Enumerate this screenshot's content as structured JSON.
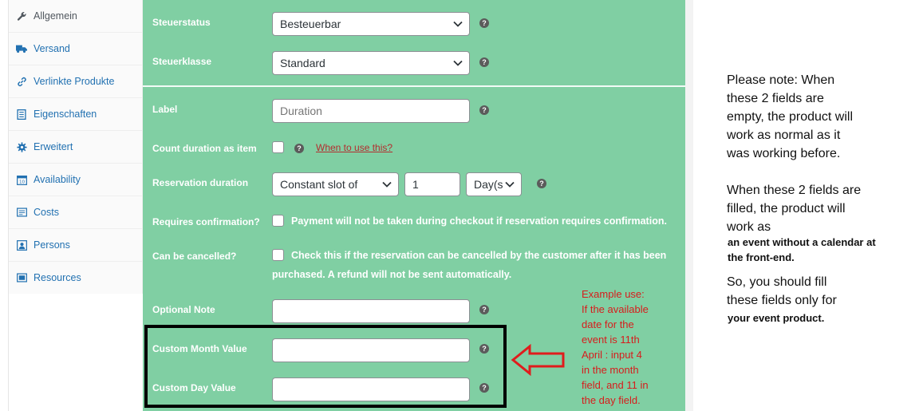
{
  "sidebar": {
    "items": [
      {
        "label": "Allgemein",
        "icon": "wrench-icon"
      },
      {
        "label": "Versand",
        "icon": "truck-icon"
      },
      {
        "label": "Verlinkte Produkte",
        "icon": "link-icon"
      },
      {
        "label": "Eigenschaften",
        "icon": "list-icon"
      },
      {
        "label": "Erweitert",
        "icon": "gear-icon"
      },
      {
        "label": "Availability",
        "icon": "calendar-icon"
      },
      {
        "label": "Costs",
        "icon": "costs-icon"
      },
      {
        "label": "Persons",
        "icon": "persons-icon"
      },
      {
        "label": "Resources",
        "icon": "resources-icon"
      }
    ]
  },
  "form": {
    "tax_status": {
      "label": "Steuerstatus",
      "value": "Besteuerbar"
    },
    "tax_class": {
      "label": "Steuerklasse",
      "value": "Standard"
    },
    "duration_label": {
      "label": "Label",
      "placeholder": "Duration"
    },
    "count_duration": {
      "label": "Count duration as item",
      "link": "When to use this?"
    },
    "reservation_duration": {
      "label": "Reservation duration",
      "type_value": "Constant slot of",
      "amount_value": "1",
      "unit_value": "Day(s"
    },
    "requires_confirmation": {
      "label": "Requires confirmation?",
      "text": "Payment will not be taken during checkout if reservation requires confirmation."
    },
    "can_be_cancelled": {
      "label": "Can be cancelled?",
      "text_line1": "Check this if the reservation can be cancelled by the customer after it has been",
      "text_line2": "purchased. A refund will not be sent automatically."
    },
    "optional_note": {
      "label": "Optional Note",
      "value": ""
    },
    "custom_month": {
      "label": "Custom Month Value",
      "value": ""
    },
    "custom_day": {
      "label": "Custom Day Value",
      "value": ""
    },
    "help_glyph": "?"
  },
  "annotation": {
    "example_lines": [
      "Example use:",
      "If the available",
      "date for the",
      "event is 11th",
      "April : input 4",
      "in the month",
      "field, and 11 in",
      "the day field."
    ],
    "example_color": "#d71c1c"
  },
  "note": {
    "para1": [
      "Please note: When",
      "these 2 fields are",
      "empty, the product will",
      "work as normal as it",
      "was working before."
    ],
    "para2": [
      "When these 2 fields are",
      "filled, the product will",
      "work as"
    ],
    "para2_bold": [
      "an event without a calendar at",
      "the front-end."
    ],
    "para3": [
      "So, you should fill",
      "these fields only for"
    ],
    "para3_bold": "your event product."
  },
  "colors": {
    "panel": "#80cfa3",
    "link": "#2271b1",
    "accent_red": "#d71c1c"
  }
}
